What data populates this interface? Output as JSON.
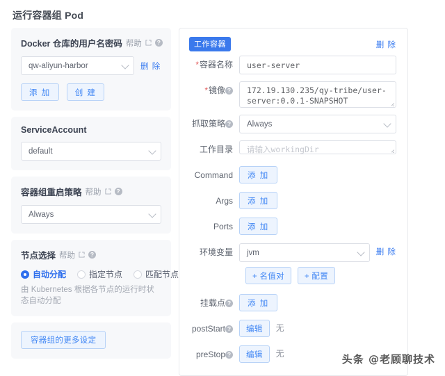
{
  "page": {
    "title": "运行容器组 Pod",
    "watermark": "头条 @老顾聊技术"
  },
  "icons": {
    "external_link": "external-link-icon",
    "question": "?",
    "chevron_down": "chevron-down-icon"
  },
  "left_panel": {
    "docker_registry": {
      "title": "Docker 仓库的用户名密码",
      "help_label": "帮助",
      "select_value": "qw-aliyun-harbor",
      "delete_label": "删 除",
      "add_label": "添 加",
      "create_label": "创 建"
    },
    "service_account": {
      "title": "ServiceAccount",
      "select_value": "default"
    },
    "restart_policy": {
      "title": "容器组重启策略",
      "help_label": "帮助",
      "select_value": "Always"
    },
    "node_selection": {
      "title": "节点选择",
      "help_label": "帮助",
      "options": [
        {
          "label": "自动分配",
          "checked": true
        },
        {
          "label": "指定节点",
          "checked": false
        },
        {
          "label": "匹配节点",
          "checked": false
        }
      ],
      "hint": "由 Kubernetes 根据各节点的运行时状态自动分配"
    },
    "more_settings": {
      "button_label": "容器组的更多设定"
    }
  },
  "right_panel": {
    "badge": "工作容器",
    "delete_label": "删 除",
    "fields": {
      "container_name": {
        "label": "容器名称",
        "required": true,
        "value": "user-server"
      },
      "image": {
        "label": "镜像",
        "required": true,
        "has_help": true,
        "value": "172.19.130.235/qy-tribe/user-server:0.0.1-SNAPSHOT"
      },
      "pull_policy": {
        "label": "抓取策略",
        "has_help": true,
        "value": "Always"
      },
      "working_dir": {
        "label": "工作目录",
        "placeholder": "请输入workingDir",
        "value": ""
      },
      "command": {
        "label": "Command",
        "button_label": "添 加"
      },
      "args": {
        "label": "Args",
        "button_label": "添 加"
      },
      "ports": {
        "label": "Ports",
        "button_label": "添 加"
      },
      "env": {
        "label": "环境变量",
        "value": "jvm",
        "delete_label": "删 除",
        "add_pair_label": "+ 名值对",
        "add_config_label": "+ 配置"
      },
      "mounts": {
        "label": "挂载点",
        "has_help": true,
        "button_label": "添 加"
      },
      "post_start": {
        "label": "postStart",
        "has_help": true,
        "button_label": "编辑",
        "value": "无"
      },
      "pre_stop": {
        "label": "preStop",
        "has_help": true,
        "button_label": "编辑",
        "value": "无"
      }
    }
  },
  "colors": {
    "primary": "#3a79ec",
    "link": "#3a7cf0",
    "btn_bg": "#edf4fe",
    "btn_border": "#b7d2f7",
    "card_bg": "#f7f8fa",
    "required": "#e35d5d"
  }
}
